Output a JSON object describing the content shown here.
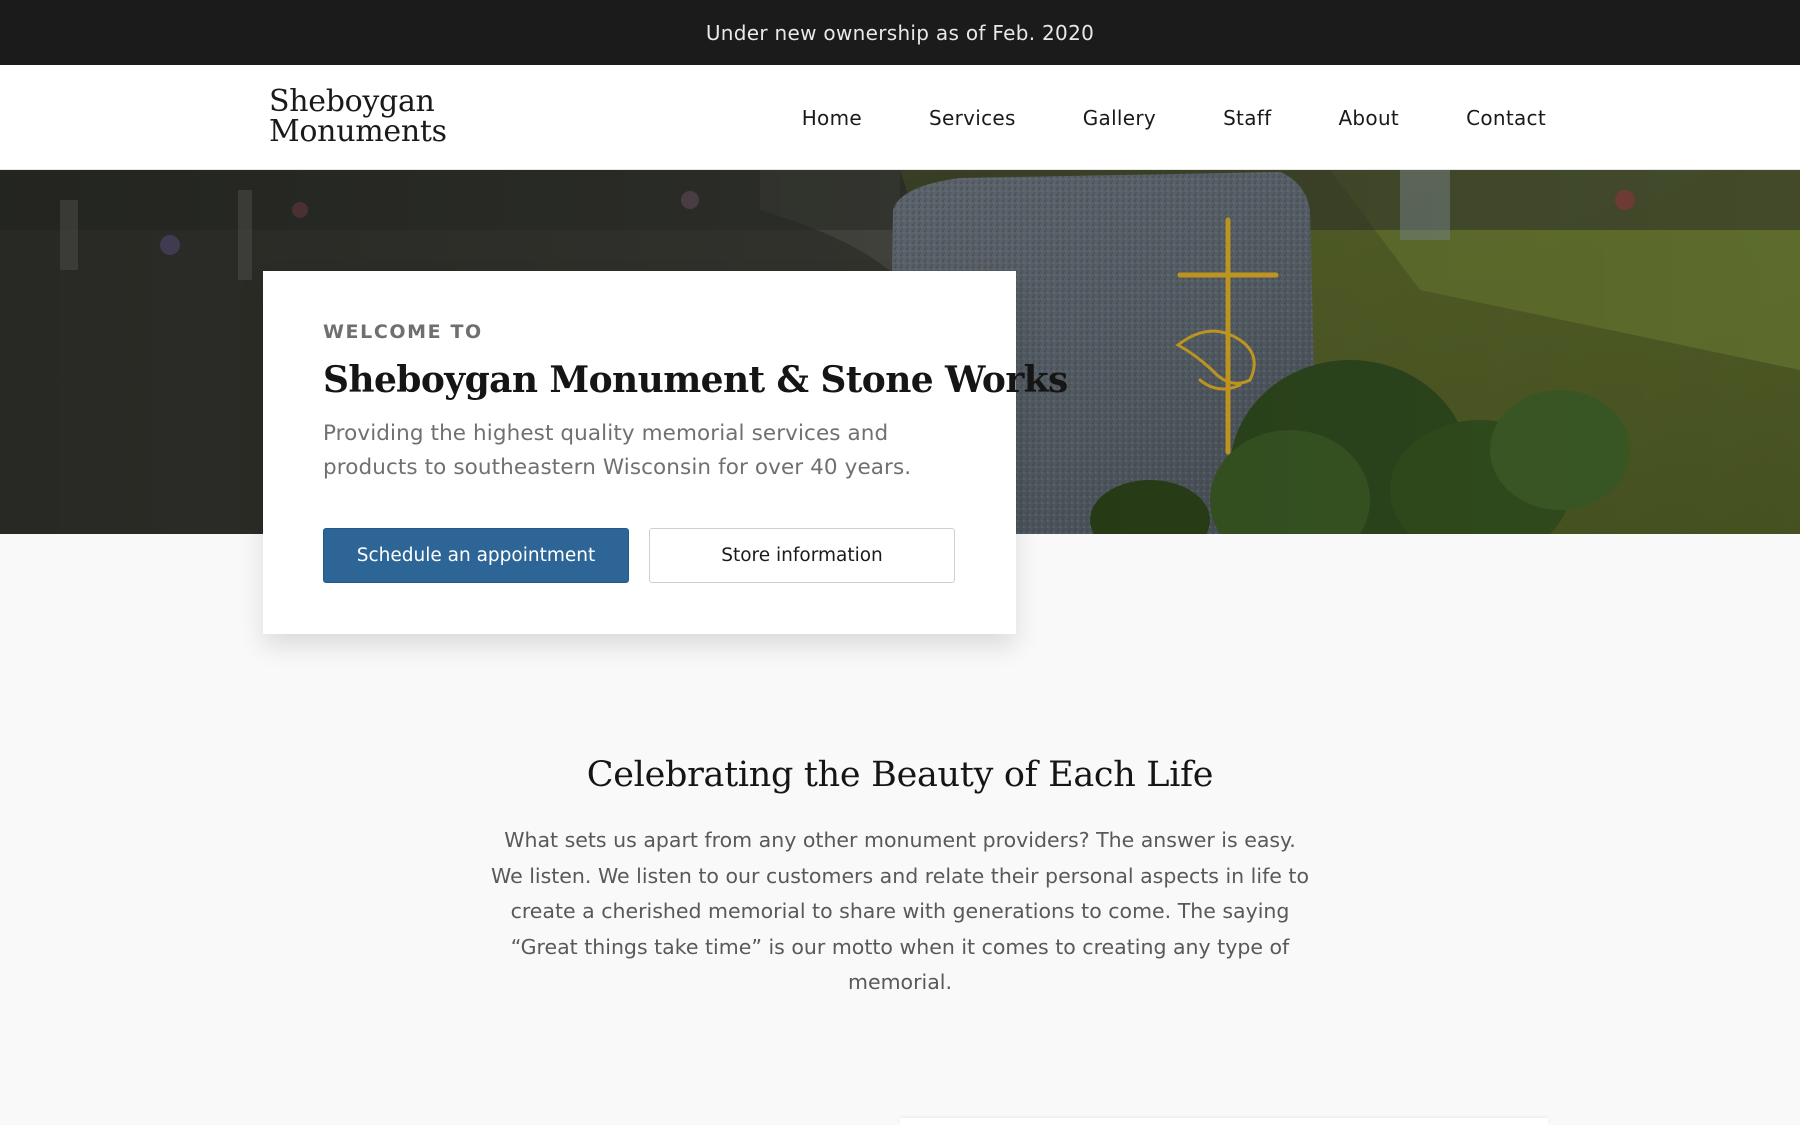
{
  "announcement": {
    "text": "Under new ownership as of Feb. 2020"
  },
  "header": {
    "logo_line1": "Sheboygan",
    "logo_line2": "Monuments",
    "nav": [
      "Home",
      "Services",
      "Gallery",
      "Staff",
      "About",
      "Contact"
    ]
  },
  "hero": {
    "eyebrow": "WELCOME TO",
    "title": "Sheboygan Monument & Stone Works",
    "description": "Providing the highest quality memorial services and products to southeastern Wisconsin for over 40 years.",
    "primary_button": "Schedule an appointment",
    "secondary_button": "Store information"
  },
  "about": {
    "heading": "Celebrating the Beauty of Each Life",
    "body": "What sets us apart from any other monument providers? The answer is easy. We listen. We listen to our customers and relate their personal aspects in life to create a cherished memorial to share with generations to come. The saying “Great things take time” is our motto when it comes to creating any type of memorial."
  },
  "colors": {
    "announcement_bg": "#1b1b1b",
    "primary_button": "#2d6597",
    "page_bg": "#f9f9f9",
    "cross_gold": "#d9a925"
  }
}
